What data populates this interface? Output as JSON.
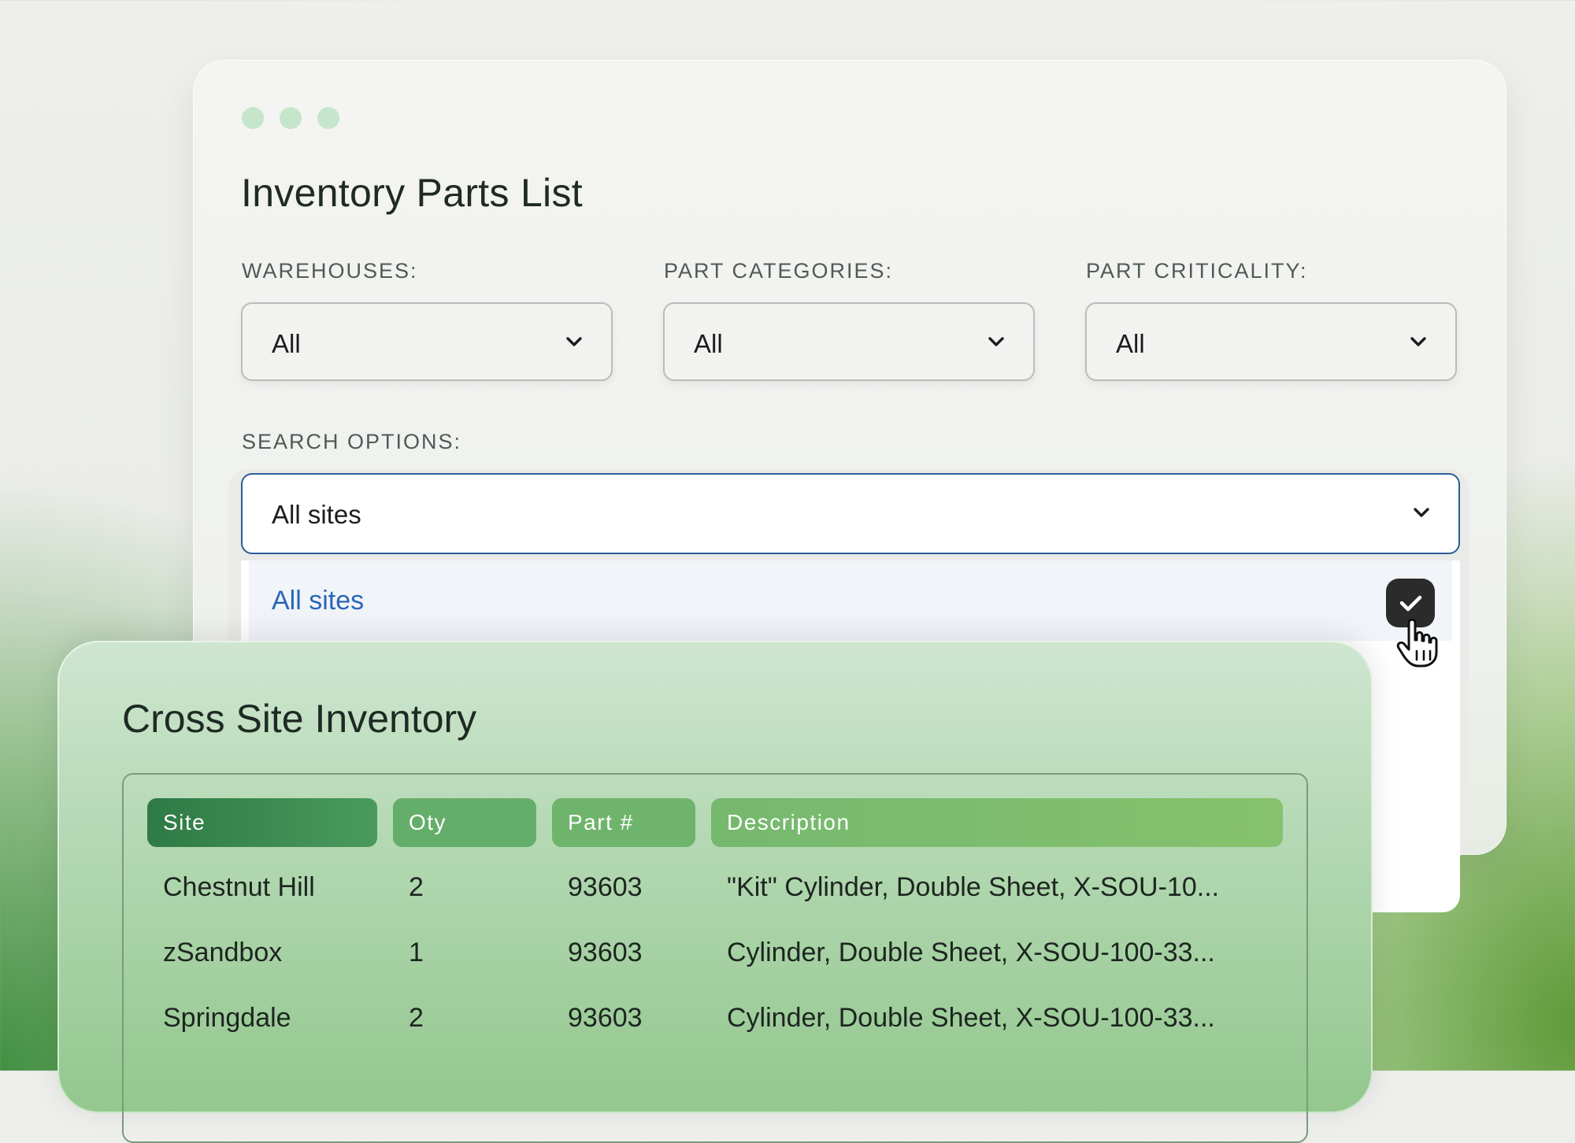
{
  "panel": {
    "title": "Inventory Parts List",
    "filters": [
      {
        "label": "WAREHOUSES:",
        "value": "All"
      },
      {
        "label": "PART CATEGORIES:",
        "value": "All"
      },
      {
        "label": "PART CRITICALITY:",
        "value": "All"
      }
    ],
    "search": {
      "label": "SEARCH OPTIONS:",
      "value": "All sites",
      "options": [
        {
          "label": "All sites",
          "selected": true
        }
      ]
    }
  },
  "inventory": {
    "title": "Cross Site Inventory",
    "columns": [
      "Site",
      "Oty",
      "Part #",
      "Description"
    ],
    "rows": [
      [
        "Chestnut Hill",
        "2",
        "93603",
        "\"Kit\" Cylinder, Double Sheet, X-SOU-10..."
      ],
      [
        "zSandbox",
        "1",
        "93603",
        "Cylinder, Double Sheet, X-SOU-100-33..."
      ],
      [
        "Springdale",
        "2",
        "93603",
        "Cylinder, Double Sheet, X-SOU-100-33..."
      ]
    ]
  },
  "colors": {
    "accent_blue": "#2a66b8",
    "select_focus_border": "#2b5e9a",
    "header_dark_green": "#3c8a52",
    "header_light_green": "#86c26d"
  },
  "icons": [
    "chevron-down-icon",
    "check-icon",
    "hand-cursor-icon"
  ]
}
